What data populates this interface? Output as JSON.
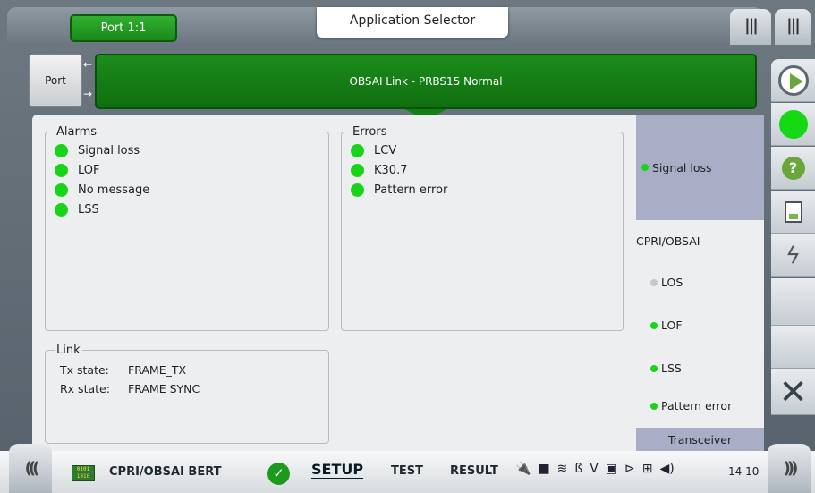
{
  "header": {
    "port_tab": "Port 1:1",
    "app_selector": "Application Selector",
    "port_button": "Port",
    "link_title": "OBSAI Link - PRBS15 Normal"
  },
  "alarms": {
    "title": "Alarms",
    "items": [
      "Signal loss",
      "LOF",
      "No message",
      "LSS"
    ],
    "status_color": "#18d418"
  },
  "errors": {
    "title": "Errors",
    "items": [
      "LCV",
      "K30.7",
      "Pattern error"
    ]
  },
  "link": {
    "title": "Link",
    "tx_label": "Tx state:",
    "tx_value": "FRAME_TX",
    "rx_label": "Rx state:",
    "rx_value": "FRAME SYNC"
  },
  "side_panel": {
    "signal": "Signal loss",
    "section_title": "CPRI/OBSAI",
    "items": [
      {
        "label": "LOS",
        "status": "inactive"
      },
      {
        "label": "LOF",
        "status": "ok"
      },
      {
        "label": "LSS",
        "status": "ok"
      },
      {
        "label": "Pattern error",
        "status": "ok"
      }
    ],
    "transceiver": "Transceiver"
  },
  "right_toolbar": [
    "play-icon",
    "status-led-icon",
    "help-icon",
    "report-icon",
    "lightning-icon",
    "close-icon"
  ],
  "bottom_bar": {
    "app_name": "CPRI/OBSAI BERT",
    "tabs": [
      "SETUP",
      "TEST",
      "RESULT"
    ],
    "active_tab": "SETUP",
    "time": "14 10"
  }
}
